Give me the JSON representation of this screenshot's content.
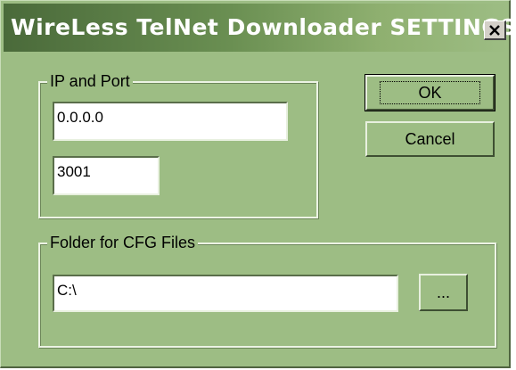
{
  "window": {
    "title": "WireLess TelNet Downloader SETTINGS"
  },
  "titlebar": {
    "close_icon": "close-x-icon"
  },
  "ip_group": {
    "label": "IP and Port",
    "ip_value": "0.0.0.0",
    "port_value": "3001"
  },
  "buttons": {
    "ok_label": "OK",
    "cancel_label": "Cancel",
    "browse_label": "..."
  },
  "folder_group": {
    "label": "Folder for CFG Files",
    "path_value": "C:\\"
  }
}
